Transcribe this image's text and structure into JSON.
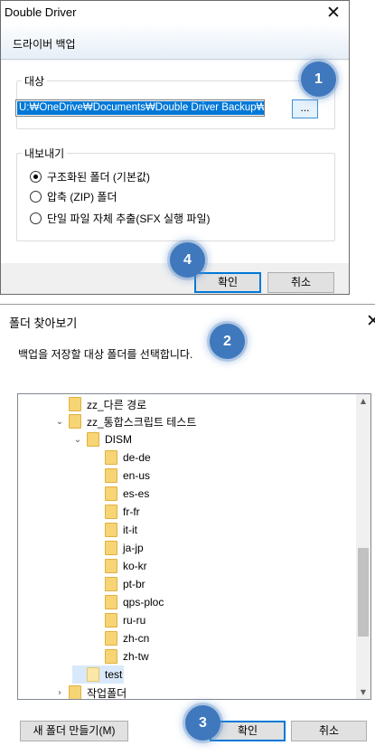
{
  "backup_dialog": {
    "title": "Double Driver",
    "header": "드라이버 백업",
    "target_group_label": "대상",
    "path_value": "U:₩OneDrive₩Documents₩Double Driver Backup₩",
    "browse_label": "...",
    "export_group_label": "내보내기",
    "options": [
      {
        "label": "구조화된 폴더 (기본값)",
        "selected": true
      },
      {
        "label": "압축 (ZIP) 폴더",
        "selected": false
      },
      {
        "label": "단일 파일 자체 추출(SFX 실행 파일)",
        "selected": false
      }
    ],
    "ok_label": "확인",
    "cancel_label": "취소"
  },
  "browse_dialog": {
    "title": "폴더 찾아보기",
    "instruction": "백업을 저장할 대상 폴더를 선택합니다.",
    "tree": [
      {
        "label": "zz_다른 경로",
        "chevron": ""
      },
      {
        "label": "zz_통합스크립트 테스트",
        "chevron": "expanded"
      },
      {
        "label": "DISM",
        "chevron": "expanded"
      },
      {
        "label": "de-de",
        "chevron": ""
      },
      {
        "label": "en-us",
        "chevron": ""
      },
      {
        "label": "es-es",
        "chevron": ""
      },
      {
        "label": "fr-fr",
        "chevron": ""
      },
      {
        "label": "it-it",
        "chevron": ""
      },
      {
        "label": "ja-jp",
        "chevron": ""
      },
      {
        "label": "ko-kr",
        "chevron": ""
      },
      {
        "label": "pt-br",
        "chevron": ""
      },
      {
        "label": "qps-ploc",
        "chevron": ""
      },
      {
        "label": "ru-ru",
        "chevron": ""
      },
      {
        "label": "zh-cn",
        "chevron": ""
      },
      {
        "label": "zh-tw",
        "chevron": ""
      },
      {
        "label": "test",
        "chevron": "",
        "selected": true
      },
      {
        "label": "작업폴더",
        "chevron": "collapsed"
      }
    ],
    "new_folder_label": "새 폴더 만들기(M)",
    "ok_label": "확인",
    "cancel_label": "취소"
  },
  "badges": [
    "1",
    "2",
    "3",
    "4"
  ],
  "colors": {
    "accent": "#0078d7",
    "badge": "#3f78bd",
    "folder": "#f7d574"
  }
}
